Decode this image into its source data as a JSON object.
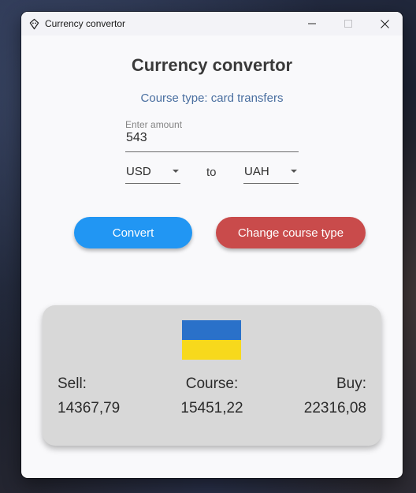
{
  "window": {
    "title": "Currency convertor",
    "icon": "piggy-bank-icon"
  },
  "header": {
    "title": "Currency convertor",
    "course_type": "Course type: card transfers"
  },
  "amount": {
    "label": "Enter amount",
    "value": "543"
  },
  "conversion": {
    "from": "USD",
    "to_label": "to",
    "to": "UAH"
  },
  "buttons": {
    "convert": "Convert",
    "change_course_type": "Change course type"
  },
  "result": {
    "flag": "ukraine-flag",
    "sell_label": "Sell:",
    "sell_value": "14367,79",
    "course_label": "Course:",
    "course_value": "15451,22",
    "buy_label": "Buy:",
    "buy_value": "22316,08"
  },
  "colors": {
    "convert_button": "#2196f3",
    "change_button": "#c94b4b",
    "course_type_text": "#4a6fa0",
    "flag_blue": "#2a71c9",
    "flag_yellow": "#f7d91c"
  }
}
